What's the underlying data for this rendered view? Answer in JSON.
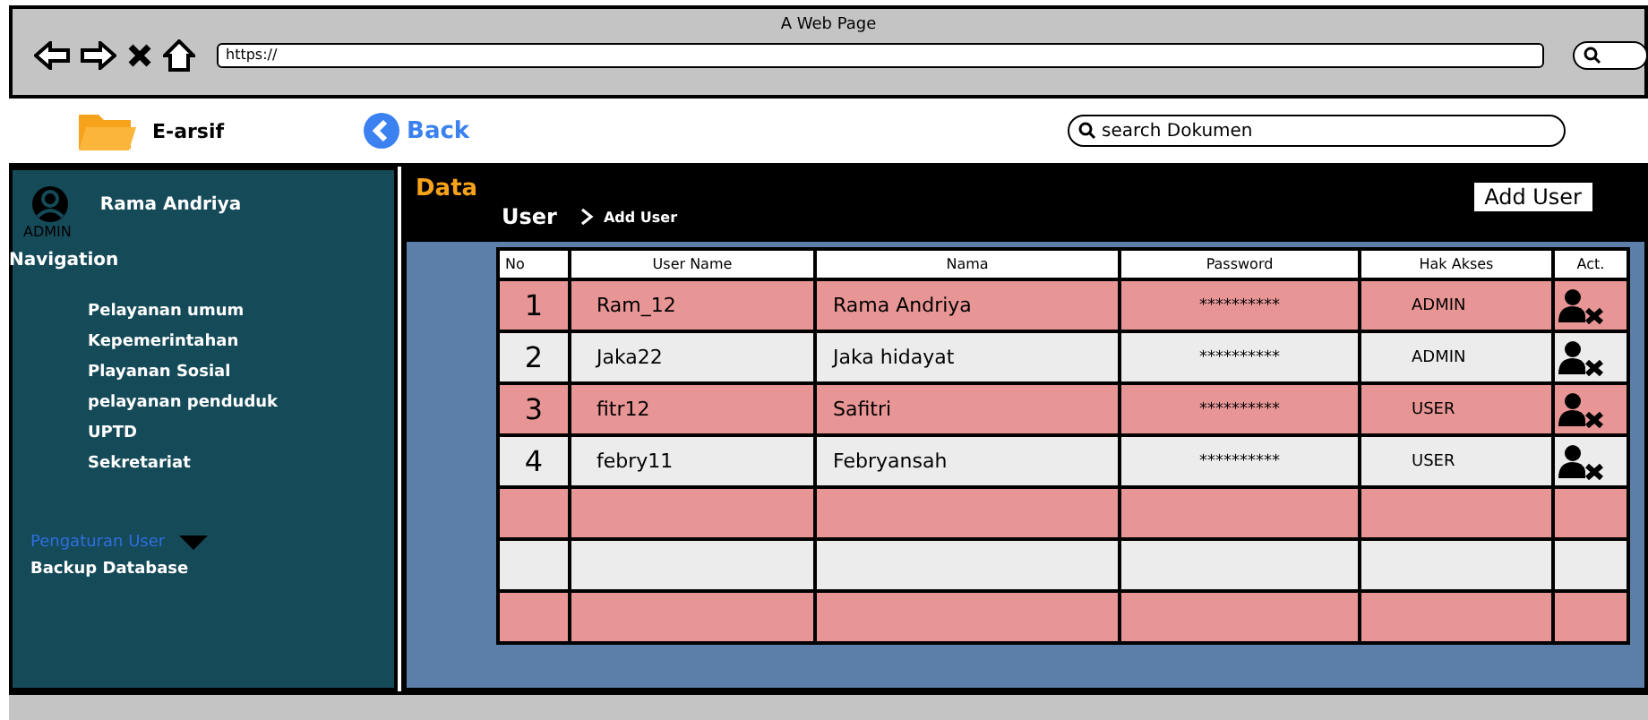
{
  "browser": {
    "title": "A Web Page",
    "url": "https://"
  },
  "header": {
    "app_name": "E-arsif",
    "back": "Back",
    "search": {
      "placeholder": "search Dokumen"
    }
  },
  "sidebar": {
    "user": {
      "name": "Rama Andriya",
      "role": "ADMIN"
    },
    "nav_title": "Navigation",
    "items": [
      {
        "label": "Pelayanan umum",
        "selected": false
      },
      {
        "label": "Kepemerintahan",
        "selected": false
      },
      {
        "label": "Playanan Sosial",
        "selected": false
      },
      {
        "label": "pelayanan penduduk",
        "selected": false
      },
      {
        "label": "UPTD",
        "selected": false
      },
      {
        "label": "Sekretariat",
        "selected": false
      }
    ],
    "settings": [
      {
        "label": "Pengaturan User",
        "selected": true,
        "dropdown": true
      },
      {
        "label": "Backup Database",
        "selected": false,
        "dropdown": false
      }
    ]
  },
  "main": {
    "title": "Data",
    "breadcrumb": [
      "User",
      "Add User"
    ],
    "add_button": "Add User",
    "table": {
      "columns": [
        "No",
        "User Name",
        "Nama",
        "Password",
        "Hak Akses",
        "Act."
      ],
      "rows": [
        {
          "kind": "user",
          "cells": [
            "1",
            "Ram_12",
            "Rama Andriya",
            "**********",
            "ADMIN"
          ]
        },
        {
          "kind": "user",
          "cells": [
            "2",
            "Jaka22",
            "Jaka hidayat",
            "**********",
            "ADMIN"
          ]
        },
        {
          "kind": "user",
          "cells": [
            "3",
            "fitr12",
            "Safitri",
            "**********",
            "USER"
          ]
        },
        {
          "kind": "user",
          "cells": [
            "4",
            "febry11",
            "Febryansah",
            "**********",
            "USER"
          ]
        },
        {
          "kind": "empty"
        },
        {
          "kind": "empty"
        },
        {
          "kind": "empty"
        }
      ]
    }
  }
}
